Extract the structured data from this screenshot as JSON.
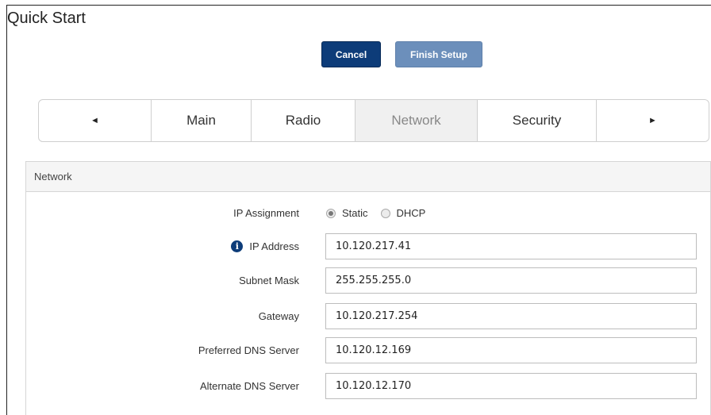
{
  "page": {
    "title": "Quick Start"
  },
  "actions": {
    "cancel": "Cancel",
    "finish": "Finish Setup"
  },
  "tabs": {
    "prev": "◄",
    "next": "►",
    "items": [
      {
        "label": "Main",
        "active": false
      },
      {
        "label": "Radio",
        "active": false
      },
      {
        "label": "Network",
        "active": true
      },
      {
        "label": "Security",
        "active": false
      }
    ]
  },
  "panel": {
    "title": "Network",
    "ip_assignment": {
      "label": "IP Assignment",
      "options": [
        {
          "label": "Static",
          "checked": true
        },
        {
          "label": "DHCP",
          "checked": false
        }
      ]
    },
    "fields": {
      "ip_address": {
        "label": "IP Address",
        "value": "10.120.217.41"
      },
      "subnet_mask": {
        "label": "Subnet Mask",
        "value": "255.255.255.0"
      },
      "gateway": {
        "label": "Gateway",
        "value": "10.120.217.254"
      },
      "preferred_dns": {
        "label": "Preferred DNS Server",
        "value": "10.120.12.169"
      },
      "alternate_dns": {
        "label": "Alternate DNS Server",
        "value": "10.120.12.170"
      }
    }
  },
  "icons": {
    "info": "info-icon"
  },
  "colors": {
    "primary": "#0d3c79",
    "primary_disabled": "#6c8fbb",
    "active_tab_bg": "#f0f0f0"
  }
}
